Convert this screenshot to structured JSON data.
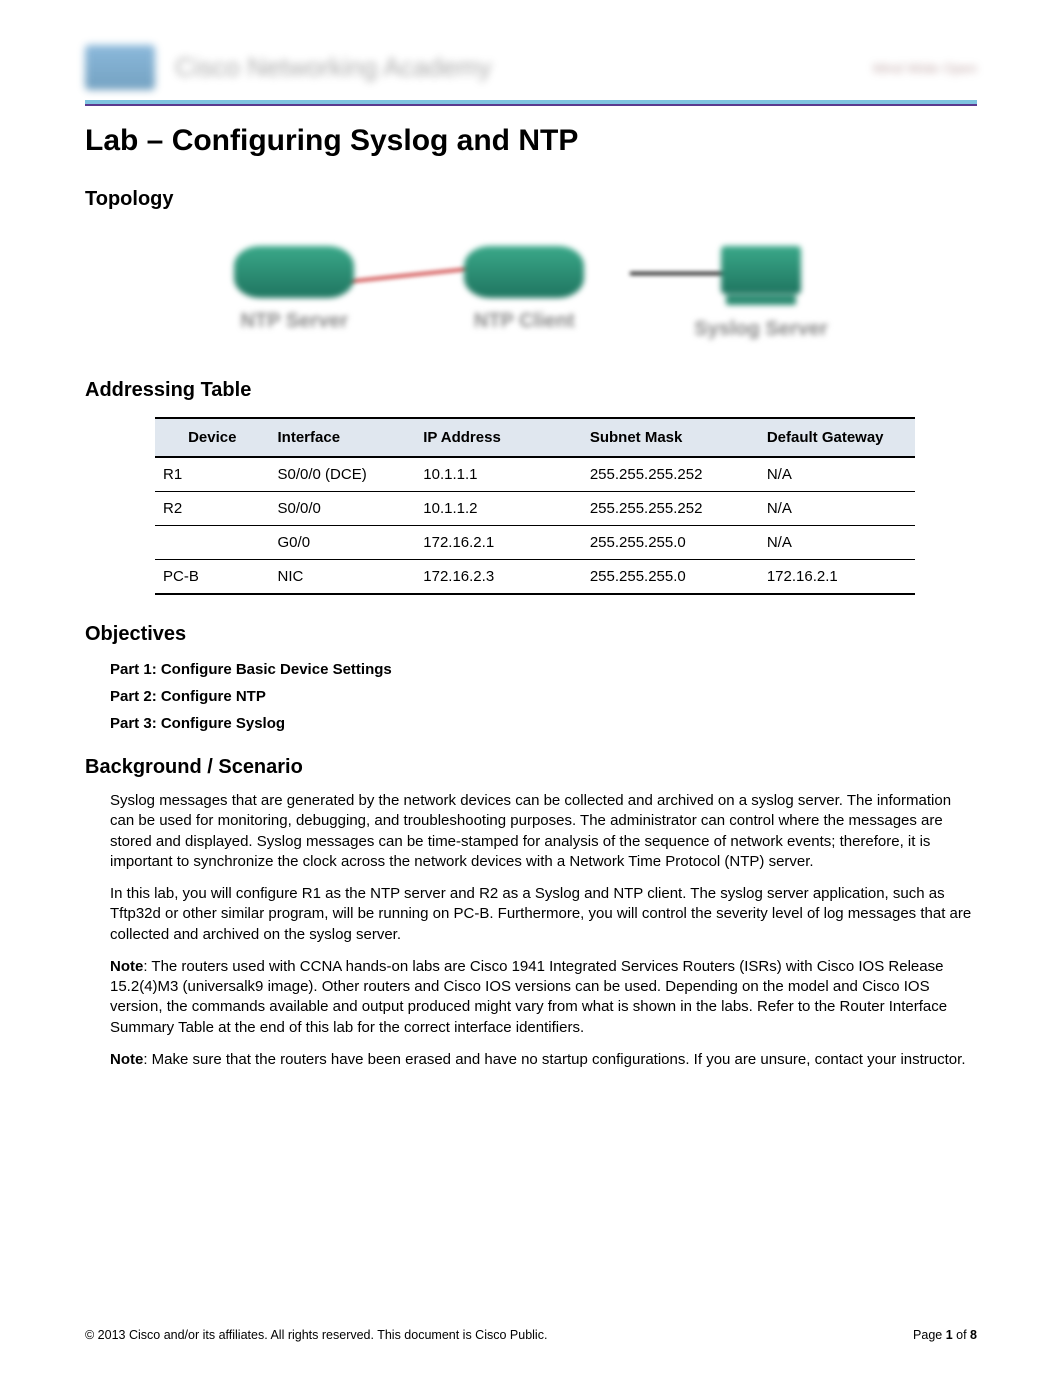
{
  "header": {
    "academy_text": "Cisco Networking Academy",
    "right_text": "Mind Wide Open"
  },
  "title": "Lab – Configuring Syslog and NTP",
  "topology": {
    "heading": "Topology",
    "devices": [
      {
        "label": "NTP Server"
      },
      {
        "label": "NTP Client"
      },
      {
        "label": "Syslog Server"
      }
    ]
  },
  "addressing": {
    "heading": "Addressing Table",
    "columns": [
      "Device",
      "Interface",
      "IP Address",
      "Subnet Mask",
      "Default Gateway"
    ],
    "rows": [
      {
        "device": "R1",
        "iface": "S0/0/0 (DCE)",
        "ip": "10.1.1.1",
        "mask": "255.255.255.252",
        "gw": "N/A"
      },
      {
        "device": "R2",
        "iface": "S0/0/0",
        "ip": "10.1.1.2",
        "mask": "255.255.255.252",
        "gw": "N/A"
      },
      {
        "device": "",
        "iface": "G0/0",
        "ip": "172.16.2.1",
        "mask": "255.255.255.0",
        "gw": "N/A"
      },
      {
        "device": "PC-B",
        "iface": "NIC",
        "ip": "172.16.2.3",
        "mask": "255.255.255.0",
        "gw": "172.16.2.1"
      }
    ]
  },
  "objectives": {
    "heading": "Objectives",
    "items": [
      "Part 1: Configure Basic Device Settings",
      "Part 2: Configure NTP",
      "Part 3: Configure Syslog"
    ]
  },
  "background": {
    "heading": "Background / Scenario",
    "note_label": "Note",
    "paras": [
      "Syslog messages that are generated by the network devices can be collected and archived on a syslog server. The information can be used for monitoring, debugging, and troubleshooting purposes. The administrator can control where the messages are stored and displayed. Syslog messages can be time-stamped for analysis of the sequence of network events; therefore, it is important to synchronize the clock across the network devices with a Network Time Protocol (NTP) server.",
      "In this lab, you will configure R1 as the NTP server and R2 as a Syslog and NTP client. The syslog server application, such as Tftp32d or other similar program, will be running on PC-B. Furthermore, you will control the severity level of log messages that are collected and archived on the syslog server.",
      ": The routers used with CCNA hands-on labs are Cisco 1941 Integrated Services Routers (ISRs) with Cisco IOS Release 15.2(4)M3 (universalk9 image). Other routers and Cisco IOS versions can be used. Depending on the model and Cisco IOS version, the commands available and output produced might vary from what is shown in the labs. Refer to the Router Interface Summary Table at the end of this lab for the correct interface identifiers.",
      ": Make sure that the routers have been erased and have no startup configurations. If you are unsure, contact your instructor."
    ]
  },
  "footer": {
    "copyright": "© 2013 Cisco and/or its affiliates. All rights reserved. This document is Cisco Public.",
    "page_prefix": "Page ",
    "page_current": "1",
    "page_sep": " of ",
    "page_total": "8"
  }
}
